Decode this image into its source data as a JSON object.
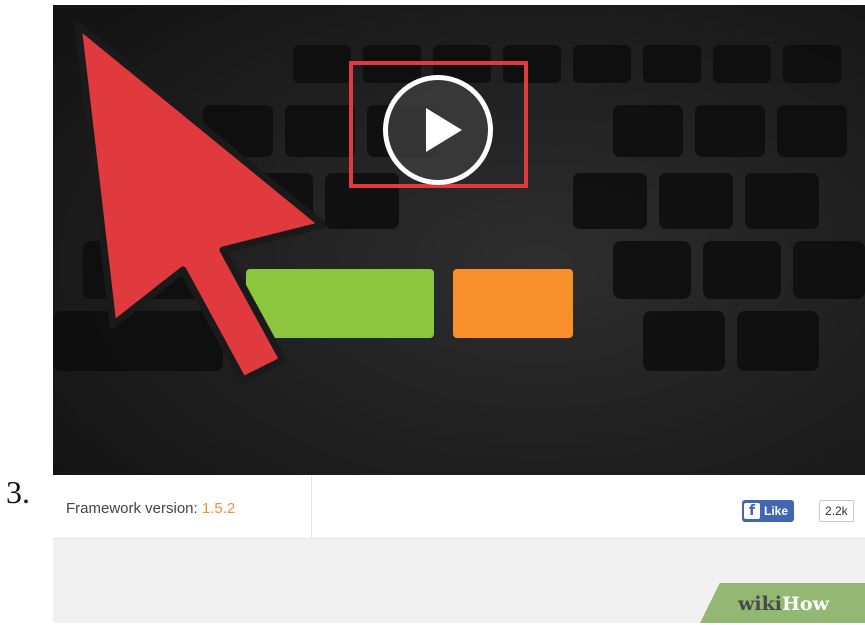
{
  "step_number": "3.",
  "video": {
    "play_button": "play-icon"
  },
  "footer": {
    "framework_label": "Framework version:",
    "framework_version": "1.5.2",
    "like_label": "Like",
    "like_count": "2.2k"
  },
  "watermark": {
    "wiki": "wiki",
    "how": "How"
  },
  "colors": {
    "highlight": "#e03a3e",
    "cursor": "#e03a3e",
    "green_button": "#8cc63f",
    "orange_button": "#f7902a",
    "facebook_blue": "#4267b2",
    "wikihow_green": "#93b874"
  }
}
